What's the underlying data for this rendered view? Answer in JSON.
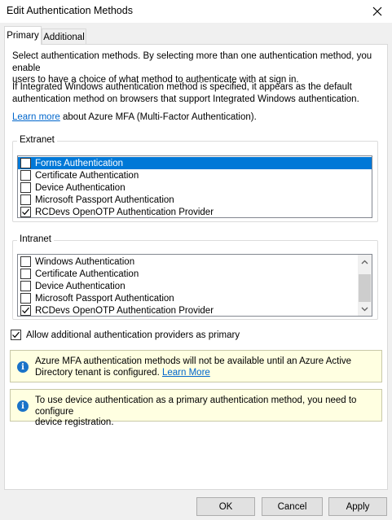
{
  "window": {
    "title": "Edit Authentication Methods"
  },
  "tabs": [
    {
      "label": "Primary",
      "active": true
    },
    {
      "label": "Additional",
      "active": false
    }
  ],
  "intro": {
    "line1": "Select authentication methods. By selecting more than one authentication method, you enable",
    "line2": "users to have a choice of what method to authenticate with at sign in."
  },
  "windows_note": {
    "line1": "If Integrated Windows authentication method is specified, it appears as the default",
    "line2": "authentication method on browsers that support Integrated Windows authentication."
  },
  "learn_more": {
    "link": "Learn more",
    "rest": " about Azure MFA (Multi-Factor Authentication)."
  },
  "extranet": {
    "label": "Extranet",
    "items": [
      {
        "label": "Forms Authentication",
        "checked": false,
        "selected": true
      },
      {
        "label": "Certificate Authentication",
        "checked": false,
        "selected": false
      },
      {
        "label": "Device Authentication",
        "checked": false,
        "selected": false
      },
      {
        "label": "Microsoft Passport Authentication",
        "checked": false,
        "selected": false
      },
      {
        "label": "RCDevs OpenOTP Authentication Provider",
        "checked": true,
        "selected": false
      }
    ]
  },
  "intranet": {
    "label": "Intranet",
    "items": [
      {
        "label": "Windows Authentication",
        "checked": false
      },
      {
        "label": "Certificate Authentication",
        "checked": false
      },
      {
        "label": "Device Authentication",
        "checked": false
      },
      {
        "label": "Microsoft Passport Authentication",
        "checked": false
      },
      {
        "label": "RCDevs OpenOTP Authentication Provider",
        "checked": true
      }
    ]
  },
  "allow_primary": {
    "label": "Allow additional authentication providers as primary",
    "checked": true
  },
  "info_mfa": {
    "line1": "Azure MFA authentication methods will not be available until an Azure Active",
    "line2": "Directory tenant is configured.",
    "link": "Learn More"
  },
  "info_device": {
    "line1": "To use device authentication as a primary authentication method, you need to configure",
    "line2": "device registration."
  },
  "buttons": {
    "ok": "OK",
    "cancel": "Cancel",
    "apply": "Apply"
  },
  "colors": {
    "selection": "#0078d7",
    "info_bg": "#ffffe1",
    "link": "#0066cc",
    "info_icon": "#1a73c8"
  }
}
